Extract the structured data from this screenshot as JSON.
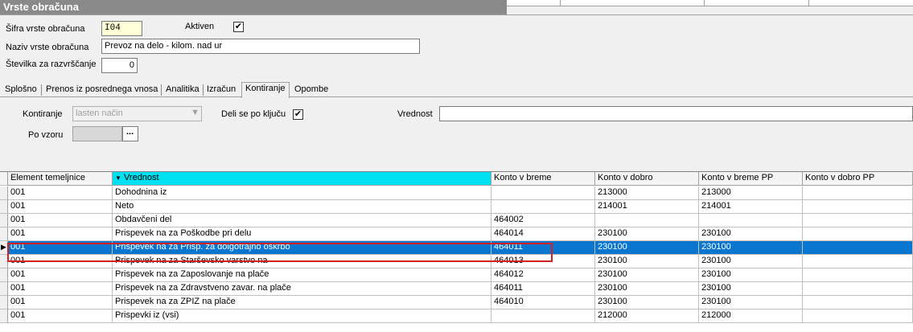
{
  "window": {
    "title": "Vrste obračuna"
  },
  "form": {
    "sifra_label": "Šifra vrste obračuna",
    "sifra_value": "I04",
    "aktiven_label": "Aktiven",
    "aktiven_checked": "✔",
    "naziv_label": "Naziv vrste obračuna",
    "naziv_value": "Prevoz na delo - kilom. nad ur",
    "stevilka_label": "Številka  za razvrščanje",
    "stevilka_value": "0"
  },
  "tabs": [
    "Splošno",
    "Prenos iz posrednega vnosa",
    "Analitika",
    "Izračun",
    "Kontiranje",
    "Opombe"
  ],
  "kontiranje": {
    "kontiranje_label": "Kontiranje",
    "kontiranje_value": "lasten način",
    "deli_label": "Deli se po ključu",
    "deli_checked": "✔",
    "vrednost_label": "Vrednost",
    "vrednost_value": "",
    "po_vzoru_label": "Po vzoru",
    "ellipsis": "..."
  },
  "grid": {
    "columns": [
      "Element temeljnice",
      "Vrednost",
      "Konto v breme",
      "Konto v dobro",
      "Konto v breme PP",
      "Konto v dobro PP"
    ],
    "sort_icon": "▼",
    "rows": [
      [
        "001",
        "Dohodnina iz",
        "",
        "213000",
        "213000",
        ""
      ],
      [
        "001",
        "Neto",
        "",
        "214001",
        "214001",
        ""
      ],
      [
        "001",
        "Obdavčeni del",
        "464002",
        "",
        "",
        ""
      ],
      [
        "001",
        "Prispevek na za Poškodbe pri delu",
        "464014",
        "230100",
        "230100",
        ""
      ],
      [
        "001",
        "Prispevek na za Prisp. za dolgotrajno oskrbo",
        "464011",
        "230100",
        "230100",
        ""
      ],
      [
        "001",
        "Prispevek na za Starševsko varstvo na",
        "464013",
        "230100",
        "230100",
        ""
      ],
      [
        "001",
        "Prispevek na za Zaposlovanje na plače",
        "464012",
        "230100",
        "230100",
        ""
      ],
      [
        "001",
        "Prispevek na za Zdravstveno zavar. na plače",
        "464011",
        "230100",
        "230100",
        ""
      ],
      [
        "001",
        "Prispevek na za ZPIZ na plače",
        "464010",
        "230100",
        "230100",
        ""
      ],
      [
        "001",
        "Prispevki iz (vsi)",
        "",
        "212000",
        "212000",
        ""
      ]
    ],
    "selected_row": 4
  }
}
